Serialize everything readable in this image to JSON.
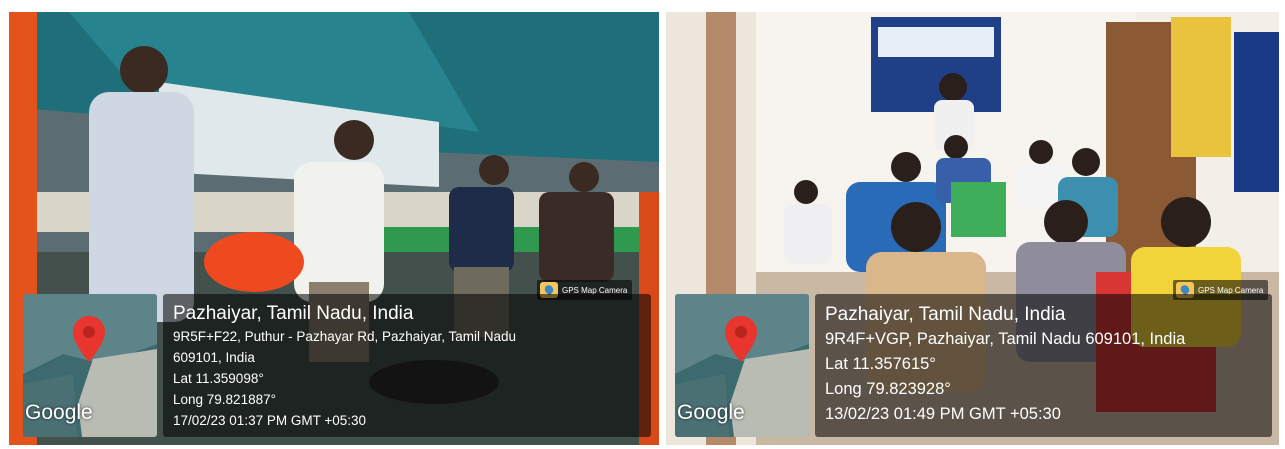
{
  "photos": [
    {
      "badge": "GPS Map Camera",
      "map_brand": "Google",
      "title": "Pazhaiyar, Tamil Nadu, India",
      "address_line1": "9R5F+F22, Puthur - Pazhayar Rd, Pazhaiyar, Tamil Nadu",
      "address_line2": "609101, India",
      "lat": "Lat 11.359098°",
      "long": "Long 79.821887°",
      "datetime": "17/02/23 01:37 PM GMT +05:30"
    },
    {
      "badge": "GPS Map Camera",
      "map_brand": "Google",
      "title": "Pazhaiyar, Tamil Nadu, India",
      "address_line1": "9R4F+VGP, Pazhaiyar, Tamil Nadu 609101, India",
      "lat": "Lat 11.357615°",
      "long": "Long 79.823928°",
      "datetime": "13/02/23 01:49 PM GMT +05:30"
    }
  ],
  "colors": {
    "pin": "#e8352d",
    "overlay": "rgba(0,0,0,0.55)",
    "boat_net": "#1f6f7a",
    "basket": "#ef4a1f",
    "deck_green": "#2f9a4f",
    "chair_green": "#3fae5a",
    "chair_red": "#d83535"
  }
}
